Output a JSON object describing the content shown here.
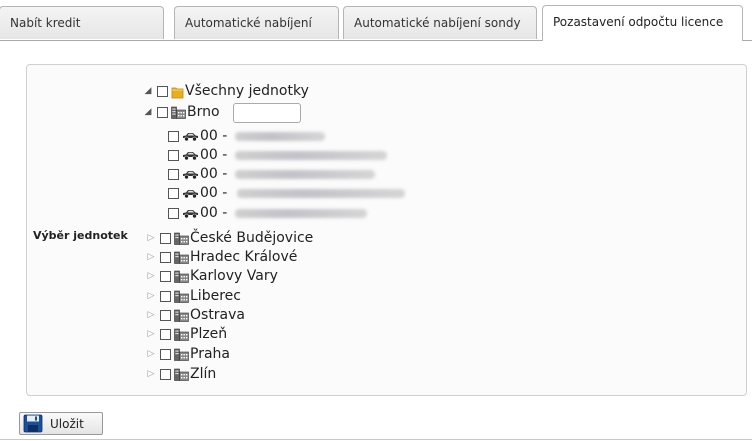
{
  "tabs": [
    {
      "label": "Nabít kredit",
      "active": false
    },
    {
      "label": "Automatické nabíjení",
      "active": false
    },
    {
      "label": "Automatické nabíjení sondy",
      "active": false
    },
    {
      "label": "Pozastavení odpočtu licence",
      "active": true
    }
  ],
  "form": {
    "field_label": "Výběr jednotek",
    "search": {
      "value": "",
      "placeholder": ""
    }
  },
  "tree": {
    "root": {
      "label": "Všechny jednotky",
      "expanded": true
    },
    "brno": {
      "label": "Brno",
      "expanded": true
    },
    "vehicles": [
      {
        "prefix": "00 -"
      },
      {
        "prefix": "00 -"
      },
      {
        "prefix": "00 -"
      },
      {
        "prefix": "00 -"
      },
      {
        "prefix": "00 -"
      }
    ],
    "branches": [
      {
        "label": "České Budějovice",
        "expanded": false
      },
      {
        "label": "Hradec Králové",
        "expanded": false
      },
      {
        "label": "Karlovy Vary",
        "expanded": false
      },
      {
        "label": "Liberec",
        "expanded": false
      },
      {
        "label": "Ostrava",
        "expanded": false
      },
      {
        "label": "Plzeň",
        "expanded": false
      },
      {
        "label": "Praha",
        "expanded": false
      },
      {
        "label": "Zlín",
        "expanded": false
      }
    ]
  },
  "actions": {
    "save_label": "Uložit"
  },
  "colors": {
    "folder": "#e8b020",
    "building": "#5a5a5a",
    "save_icon": "#1a4f9c"
  }
}
